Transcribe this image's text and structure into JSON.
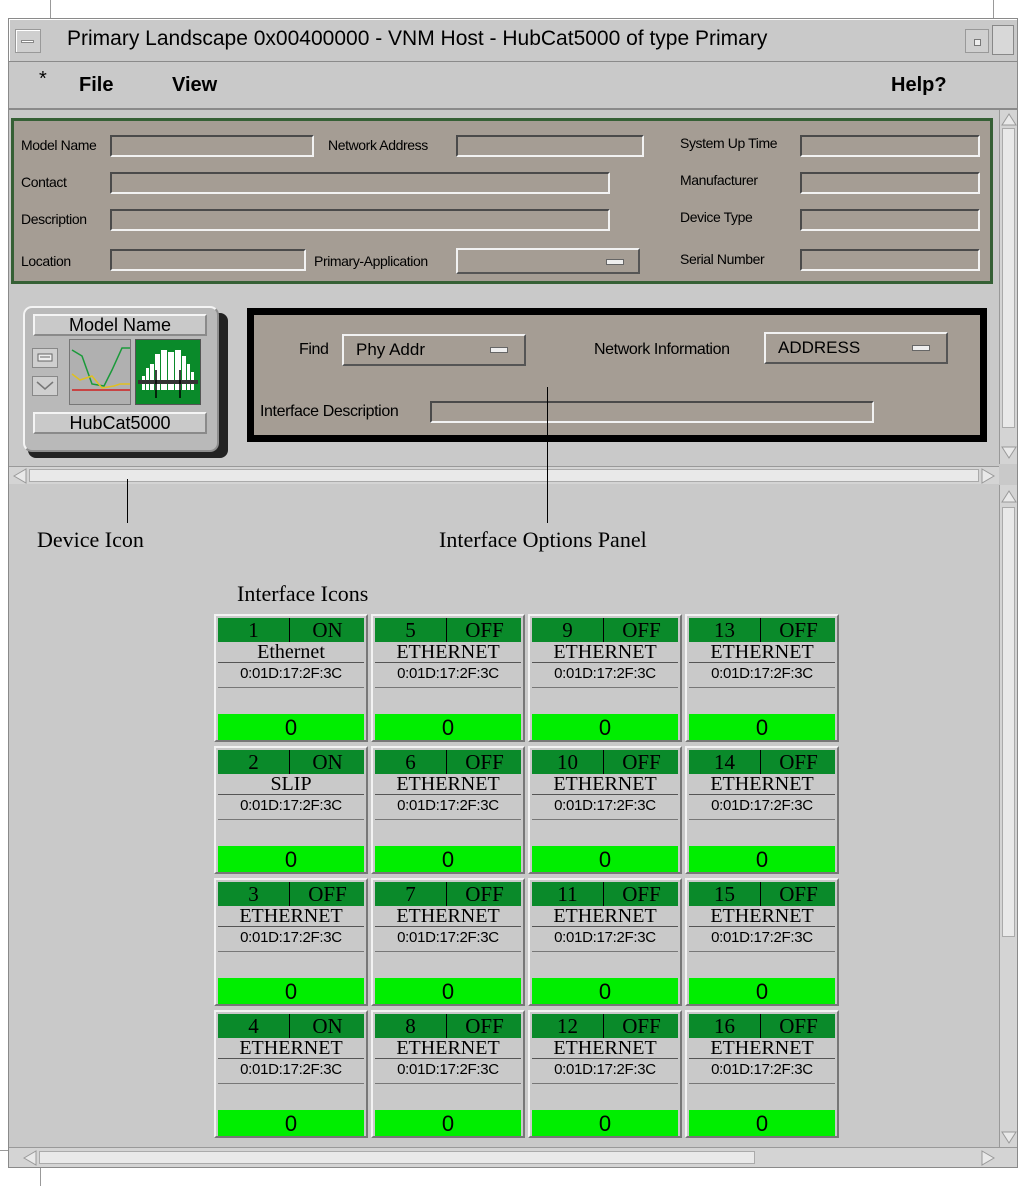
{
  "window": {
    "title": "Primary Landscape 0x00400000 - VNM Host - HubCat5000 of type Primary"
  },
  "menu": {
    "star": "*",
    "file": "File",
    "view": "View",
    "help": "Help?"
  },
  "attributes": {
    "model_name_label": "Model Name",
    "network_address_label": "Network Address",
    "system_up_time_label": "System Up Time",
    "contact_label": "Contact",
    "manufacturer_label": "Manufacturer",
    "description_label": "Description",
    "device_type_label": "Device Type",
    "location_label": "Location",
    "primary_application_label": "Primary-Application",
    "serial_number_label": "Serial Number"
  },
  "device_icon": {
    "top_label": "Model Name",
    "bottom_label": "HubCat5000"
  },
  "interface_options": {
    "find_label": "Find",
    "find_value": "Phy Addr",
    "network_info_label": "Network Information",
    "network_info_value": "ADDRESS",
    "interface_description_label": "Interface Description"
  },
  "captions": {
    "device_icon": "Device Icon",
    "interface_options_panel": "Interface Options Panel",
    "interface_icons": "Interface Icons"
  },
  "colors": {
    "panel_bg": "#a59d94",
    "port_header": "#0a8a2a",
    "port_value": "#00ee00"
  },
  "ports": [
    {
      "number": "1",
      "status": "ON",
      "type": "Ethernet",
      "address": "0:01D:17:2F:3C",
      "value": "0"
    },
    {
      "number": "5",
      "status": "OFF",
      "type": "ETHERNET",
      "address": "0:01D:17:2F:3C",
      "value": "0"
    },
    {
      "number": "9",
      "status": "OFF",
      "type": "ETHERNET",
      "address": "0:01D:17:2F:3C",
      "value": "0"
    },
    {
      "number": "13",
      "status": "OFF",
      "type": "ETHERNET",
      "address": "0:01D:17:2F:3C",
      "value": "0"
    },
    {
      "number": "2",
      "status": "ON",
      "type": "SLIP",
      "address": "0:01D:17:2F:3C",
      "value": "0"
    },
    {
      "number": "6",
      "status": "OFF",
      "type": "ETHERNET",
      "address": "0:01D:17:2F:3C",
      "value": "0"
    },
    {
      "number": "10",
      "status": "OFF",
      "type": "ETHERNET",
      "address": "0:01D:17:2F:3C",
      "value": "0"
    },
    {
      "number": "14",
      "status": "OFF",
      "type": "ETHERNET",
      "address": "0:01D:17:2F:3C",
      "value": "0"
    },
    {
      "number": "3",
      "status": "OFF",
      "type": "ETHERNET",
      "address": "0:01D:17:2F:3C",
      "value": "0"
    },
    {
      "number": "7",
      "status": "OFF",
      "type": "ETHERNET",
      "address": "0:01D:17:2F:3C",
      "value": "0"
    },
    {
      "number": "11",
      "status": "OFF",
      "type": "ETHERNET",
      "address": "0:01D:17:2F:3C",
      "value": "0"
    },
    {
      "number": "15",
      "status": "OFF",
      "type": "ETHERNET",
      "address": "0:01D:17:2F:3C",
      "value": "0"
    },
    {
      "number": "4",
      "status": "ON",
      "type": "ETHERNET",
      "address": "0:01D:17:2F:3C",
      "value": "0"
    },
    {
      "number": "8",
      "status": "OFF",
      "type": "ETHERNET",
      "address": "0:01D:17:2F:3C",
      "value": "0"
    },
    {
      "number": "12",
      "status": "OFF",
      "type": "ETHERNET",
      "address": "0:01D:17:2F:3C",
      "value": "0"
    },
    {
      "number": "16",
      "status": "OFF",
      "type": "ETHERNET",
      "address": "0:01D:17:2F:3C",
      "value": "0"
    }
  ]
}
